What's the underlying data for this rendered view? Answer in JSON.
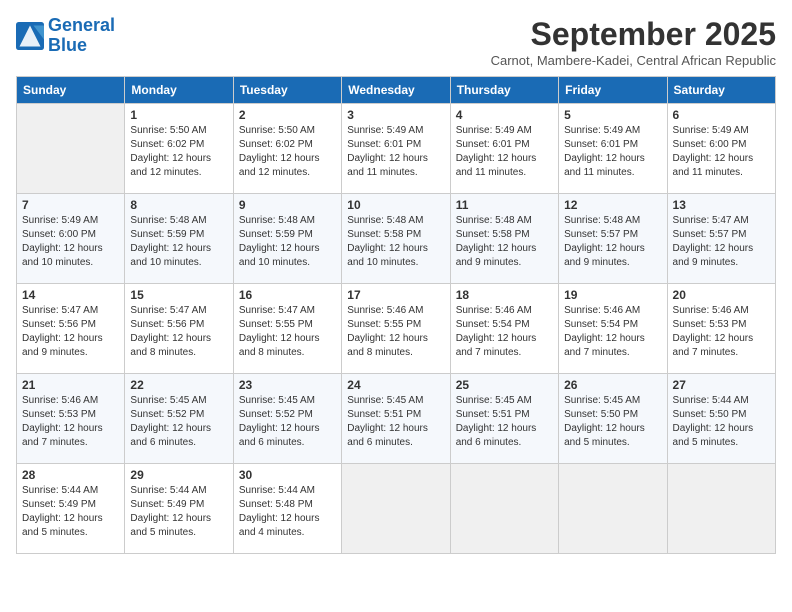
{
  "logo": {
    "line1": "General",
    "line2": "Blue"
  },
  "title": "September 2025",
  "subtitle": "Carnot, Mambere-Kadei, Central African Republic",
  "days_header": [
    "Sunday",
    "Monday",
    "Tuesday",
    "Wednesday",
    "Thursday",
    "Friday",
    "Saturday"
  ],
  "weeks": [
    [
      {
        "day": "",
        "info": ""
      },
      {
        "day": "1",
        "info": "Sunrise: 5:50 AM\nSunset: 6:02 PM\nDaylight: 12 hours\nand 12 minutes."
      },
      {
        "day": "2",
        "info": "Sunrise: 5:50 AM\nSunset: 6:02 PM\nDaylight: 12 hours\nand 12 minutes."
      },
      {
        "day": "3",
        "info": "Sunrise: 5:49 AM\nSunset: 6:01 PM\nDaylight: 12 hours\nand 11 minutes."
      },
      {
        "day": "4",
        "info": "Sunrise: 5:49 AM\nSunset: 6:01 PM\nDaylight: 12 hours\nand 11 minutes."
      },
      {
        "day": "5",
        "info": "Sunrise: 5:49 AM\nSunset: 6:01 PM\nDaylight: 12 hours\nand 11 minutes."
      },
      {
        "day": "6",
        "info": "Sunrise: 5:49 AM\nSunset: 6:00 PM\nDaylight: 12 hours\nand 11 minutes."
      }
    ],
    [
      {
        "day": "7",
        "info": "Sunrise: 5:49 AM\nSunset: 6:00 PM\nDaylight: 12 hours\nand 10 minutes."
      },
      {
        "day": "8",
        "info": "Sunrise: 5:48 AM\nSunset: 5:59 PM\nDaylight: 12 hours\nand 10 minutes."
      },
      {
        "day": "9",
        "info": "Sunrise: 5:48 AM\nSunset: 5:59 PM\nDaylight: 12 hours\nand 10 minutes."
      },
      {
        "day": "10",
        "info": "Sunrise: 5:48 AM\nSunset: 5:58 PM\nDaylight: 12 hours\nand 10 minutes."
      },
      {
        "day": "11",
        "info": "Sunrise: 5:48 AM\nSunset: 5:58 PM\nDaylight: 12 hours\nand 9 minutes."
      },
      {
        "day": "12",
        "info": "Sunrise: 5:48 AM\nSunset: 5:57 PM\nDaylight: 12 hours\nand 9 minutes."
      },
      {
        "day": "13",
        "info": "Sunrise: 5:47 AM\nSunset: 5:57 PM\nDaylight: 12 hours\nand 9 minutes."
      }
    ],
    [
      {
        "day": "14",
        "info": "Sunrise: 5:47 AM\nSunset: 5:56 PM\nDaylight: 12 hours\nand 9 minutes."
      },
      {
        "day": "15",
        "info": "Sunrise: 5:47 AM\nSunset: 5:56 PM\nDaylight: 12 hours\nand 8 minutes."
      },
      {
        "day": "16",
        "info": "Sunrise: 5:47 AM\nSunset: 5:55 PM\nDaylight: 12 hours\nand 8 minutes."
      },
      {
        "day": "17",
        "info": "Sunrise: 5:46 AM\nSunset: 5:55 PM\nDaylight: 12 hours\nand 8 minutes."
      },
      {
        "day": "18",
        "info": "Sunrise: 5:46 AM\nSunset: 5:54 PM\nDaylight: 12 hours\nand 7 minutes."
      },
      {
        "day": "19",
        "info": "Sunrise: 5:46 AM\nSunset: 5:54 PM\nDaylight: 12 hours\nand 7 minutes."
      },
      {
        "day": "20",
        "info": "Sunrise: 5:46 AM\nSunset: 5:53 PM\nDaylight: 12 hours\nand 7 minutes."
      }
    ],
    [
      {
        "day": "21",
        "info": "Sunrise: 5:46 AM\nSunset: 5:53 PM\nDaylight: 12 hours\nand 7 minutes."
      },
      {
        "day": "22",
        "info": "Sunrise: 5:45 AM\nSunset: 5:52 PM\nDaylight: 12 hours\nand 6 minutes."
      },
      {
        "day": "23",
        "info": "Sunrise: 5:45 AM\nSunset: 5:52 PM\nDaylight: 12 hours\nand 6 minutes."
      },
      {
        "day": "24",
        "info": "Sunrise: 5:45 AM\nSunset: 5:51 PM\nDaylight: 12 hours\nand 6 minutes."
      },
      {
        "day": "25",
        "info": "Sunrise: 5:45 AM\nSunset: 5:51 PM\nDaylight: 12 hours\nand 6 minutes."
      },
      {
        "day": "26",
        "info": "Sunrise: 5:45 AM\nSunset: 5:50 PM\nDaylight: 12 hours\nand 5 minutes."
      },
      {
        "day": "27",
        "info": "Sunrise: 5:44 AM\nSunset: 5:50 PM\nDaylight: 12 hours\nand 5 minutes."
      }
    ],
    [
      {
        "day": "28",
        "info": "Sunrise: 5:44 AM\nSunset: 5:49 PM\nDaylight: 12 hours\nand 5 minutes."
      },
      {
        "day": "29",
        "info": "Sunrise: 5:44 AM\nSunset: 5:49 PM\nDaylight: 12 hours\nand 5 minutes."
      },
      {
        "day": "30",
        "info": "Sunrise: 5:44 AM\nSunset: 5:48 PM\nDaylight: 12 hours\nand 4 minutes."
      },
      {
        "day": "",
        "info": ""
      },
      {
        "day": "",
        "info": ""
      },
      {
        "day": "",
        "info": ""
      },
      {
        "day": "",
        "info": ""
      }
    ]
  ]
}
